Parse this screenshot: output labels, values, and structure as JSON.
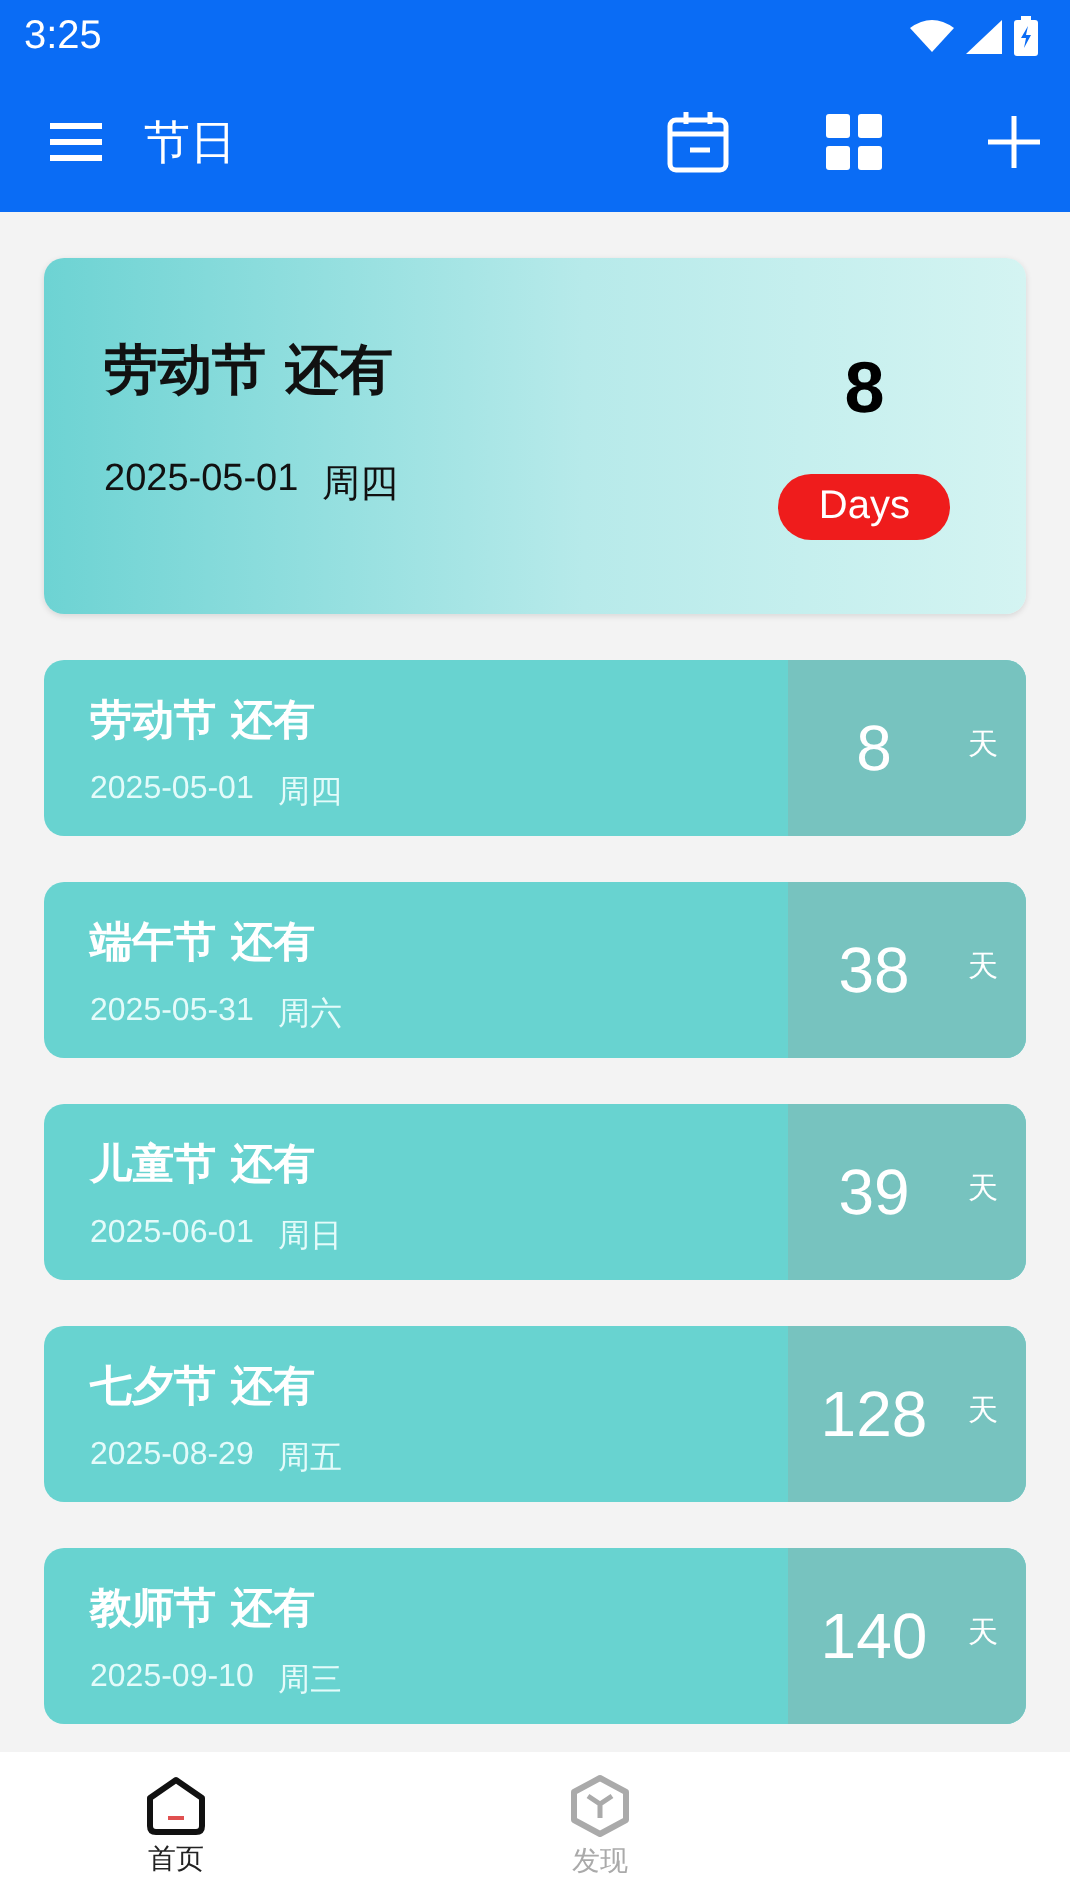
{
  "status_bar": {
    "time": "3:25"
  },
  "app_bar": {
    "title": "节日"
  },
  "featured": {
    "title": "劳动节 还有",
    "date": "2025-05-01",
    "weekday": "周四",
    "count": "8",
    "unit": "Days"
  },
  "holidays": [
    {
      "title": "劳动节 还有",
      "date": "2025-05-01",
      "weekday": "周四",
      "count": "8",
      "unit": "天"
    },
    {
      "title": "端午节 还有",
      "date": "2025-05-31",
      "weekday": "周六",
      "count": "38",
      "unit": "天"
    },
    {
      "title": "儿童节 还有",
      "date": "2025-06-01",
      "weekday": "周日",
      "count": "39",
      "unit": "天"
    },
    {
      "title": "七夕节 还有",
      "date": "2025-08-29",
      "weekday": "周五",
      "count": "128",
      "unit": "天"
    },
    {
      "title": "教师节 还有",
      "date": "2025-09-10",
      "weekday": "周三",
      "count": "140",
      "unit": "天"
    }
  ],
  "bottom_nav": [
    {
      "label": "首页",
      "kind": "home",
      "selected": true
    },
    {
      "label": "发现",
      "kind": "cube",
      "selected": false
    }
  ]
}
